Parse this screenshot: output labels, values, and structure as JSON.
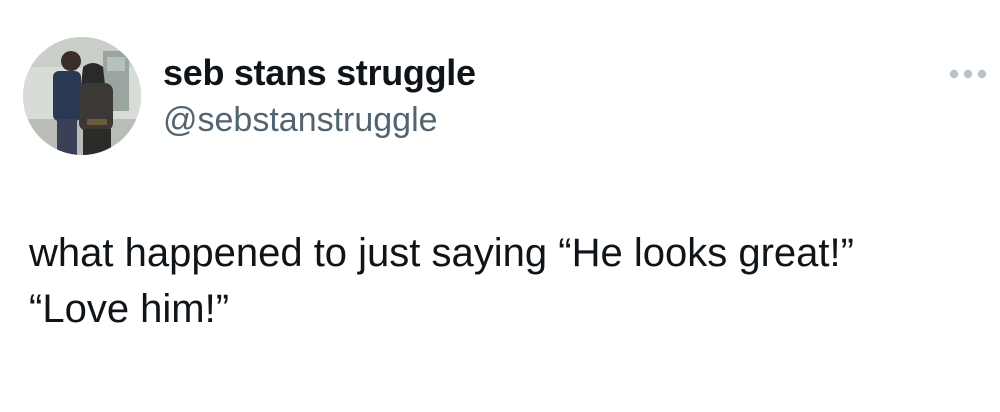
{
  "author": {
    "display_name": "seb stans struggle",
    "handle": "@sebstanstruggle",
    "avatar_icon": "profile-photo"
  },
  "menu": {
    "icon": "more-horizontal-icon"
  },
  "tweet": {
    "text_lines": [
      "what happened to just saying “He looks great!”",
      "“Love him!”"
    ]
  },
  "colors": {
    "text_primary": "#0f1419",
    "text_secondary": "#536471",
    "icon_muted": "#b8c2cb"
  }
}
